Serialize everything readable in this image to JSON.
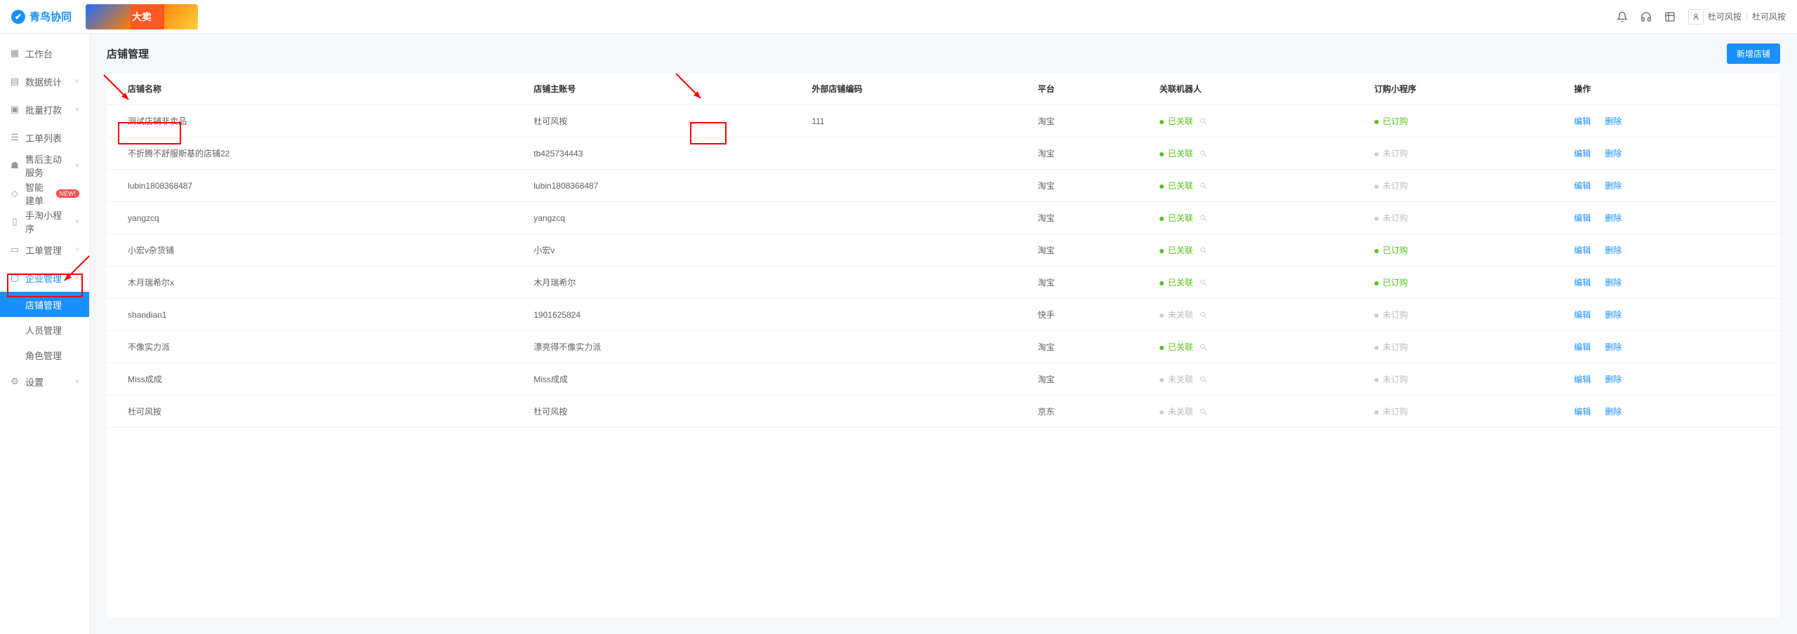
{
  "brand": "青鸟协同",
  "banner_text": "大卖",
  "user": {
    "name": "杜可风按",
    "suffix": "杜可风按"
  },
  "sidebar": {
    "items": [
      {
        "icon": "grid",
        "label": "工作台",
        "expandable": false
      },
      {
        "icon": "bars",
        "label": "数据统计",
        "expandable": true
      },
      {
        "icon": "stamp",
        "label": "批量打款",
        "expandable": true
      },
      {
        "icon": "list",
        "label": "工单列表",
        "expandable": false
      },
      {
        "icon": "headset",
        "label": "售后主动服务",
        "expandable": true
      },
      {
        "icon": "bulb",
        "label": "智能建单",
        "badge": "NEW!",
        "expandable": false
      },
      {
        "icon": "mobile",
        "label": "手淘小程序",
        "expandable": true
      },
      {
        "icon": "ticket",
        "label": "工单管理",
        "expandable": true
      },
      {
        "icon": "building",
        "label": "企业管理",
        "expandable": true,
        "active": true,
        "children": [
          {
            "label": "店铺管理",
            "active": true
          },
          {
            "label": "人员管理"
          },
          {
            "label": "角色管理"
          }
        ]
      },
      {
        "icon": "gear",
        "label": "设置",
        "expandable": true
      }
    ]
  },
  "page": {
    "title": "店铺管理",
    "add_button": "新增店铺"
  },
  "table": {
    "headers": [
      "店铺名称",
      "店铺主账号",
      "外部店铺编码",
      "平台",
      "关联机器人",
      "订购小程序",
      "操作"
    ],
    "action_edit": "编辑",
    "action_delete": "删除",
    "rows": [
      {
        "name": "测试店铺非卖品",
        "account": "杜可风按",
        "code": "111",
        "platform": "淘宝",
        "robot": "linked",
        "mini": "subscribed"
      },
      {
        "name": "不折腾不舒服斯基的店铺22",
        "account": "tb425734443",
        "code": "",
        "platform": "淘宝",
        "robot": "linked",
        "mini": "unsubscribed"
      },
      {
        "name": "lubin1808368487",
        "account": "lubin1808368487",
        "code": "",
        "platform": "淘宝",
        "robot": "linked",
        "mini": "unsubscribed"
      },
      {
        "name": "yangzcq",
        "account": "yangzcq",
        "code": "",
        "platform": "淘宝",
        "robot": "linked",
        "mini": "unsubscribed"
      },
      {
        "name": "小宏v杂货铺",
        "account": "小宏v",
        "code": "",
        "platform": "淘宝",
        "robot": "linked",
        "mini": "subscribed"
      },
      {
        "name": "木月瑞希尔x",
        "account": "木月瑞希尔",
        "code": "",
        "platform": "淘宝",
        "robot": "linked",
        "mini": "subscribed"
      },
      {
        "name": "shandian1",
        "account": "1901625824",
        "code": "",
        "platform": "快手",
        "robot": "unlinked",
        "mini": "unsubscribed"
      },
      {
        "name": "不像实力派",
        "account": "漂亮得不像实力派",
        "code": "",
        "platform": "淘宝",
        "robot": "linked",
        "mini": "unsubscribed"
      },
      {
        "name": "Miss成成",
        "account": "Miss成成",
        "code": "",
        "platform": "淘宝",
        "robot": "unlinked",
        "mini": "unsubscribed"
      },
      {
        "name": "杜可风按",
        "account": "杜可风按",
        "code": "",
        "platform": "京东",
        "robot": "unlinked",
        "mini": "unsubscribed"
      }
    ],
    "robot_status": {
      "linked": "已关联",
      "unlinked": "未关联"
    },
    "mini_status": {
      "subscribed": "已订购",
      "unsubscribed": "未订购"
    }
  }
}
